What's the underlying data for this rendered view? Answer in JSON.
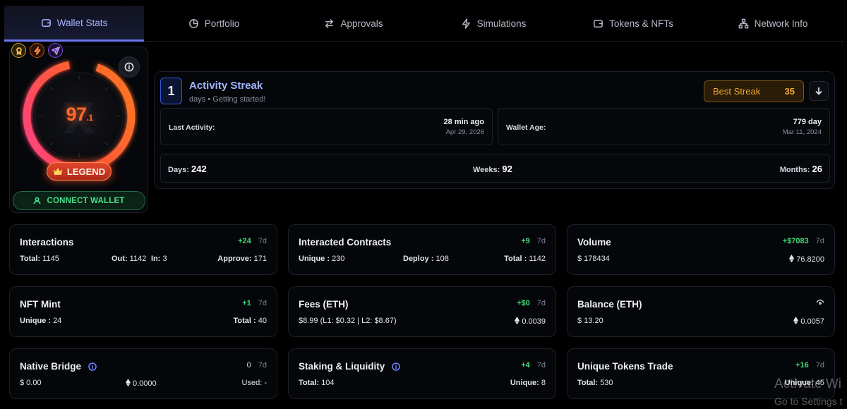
{
  "tabs": [
    {
      "label": "Wallet Stats",
      "icon": "wallet-icon"
    },
    {
      "label": "Portfolio",
      "icon": "pie-chart-icon"
    },
    {
      "label": "Approvals",
      "icon": "swap-arrows-icon"
    },
    {
      "label": "Simulations",
      "icon": "lightning-icon"
    },
    {
      "label": "Tokens & NFTs",
      "icon": "wallet-icon"
    },
    {
      "label": "Network Info",
      "icon": "network-icon"
    }
  ],
  "score": {
    "value": "97",
    "decimal": ".1",
    "rank": "LEGEND",
    "connect_label": "CONNECT WALLET",
    "badges": [
      "medal-icon",
      "lightning-icon",
      "send-icon"
    ],
    "colors": {
      "accent": "#ff6a2b",
      "ring_start": "#ff3d8a",
      "ring_end": "#ff7a1f"
    }
  },
  "streak": {
    "count": "1",
    "title": "Activity Streak",
    "subtitle": "days • Getting started!",
    "best_label": "Best Streak",
    "best_value": "35",
    "last_activity_label": "Last Activity:",
    "last_activity_value": "28 min ago",
    "last_activity_date": "Apr 29, 2026",
    "wallet_age_label": "Wallet Age:",
    "wallet_age_value": "779 day",
    "wallet_age_date": "Mar 11, 2024",
    "days_label": "Days:",
    "days_value": "242",
    "weeks_label": "Weeks:",
    "weeks_value": "92",
    "months_label": "Months:",
    "months_value": "26"
  },
  "stats": {
    "interactions": {
      "title": "Interactions",
      "delta": "+24",
      "period": "7d",
      "total_label": "Total:",
      "total": "1145",
      "out_label": "Out:",
      "out": "1142",
      "in_label": "In:",
      "in": "3",
      "approve_label": "Approve:",
      "approve": "171"
    },
    "contracts": {
      "title": "Interacted Contracts",
      "delta": "+9",
      "period": "7d",
      "unique_label": "Unique :",
      "unique": "230",
      "deploy_label": "Deploy :",
      "deploy": "108",
      "total_label": "Total :",
      "total": "1142"
    },
    "volume": {
      "title": "Volume",
      "delta": "+$7083",
      "period": "7d",
      "usd": "$ 178434",
      "eth": "76.8200"
    },
    "nft": {
      "title": "NFT Mint",
      "delta": "+1",
      "period": "7d",
      "unique_label": "Unique :",
      "unique": "24",
      "total_label": "Total :",
      "total": "40"
    },
    "fees": {
      "title": "Fees (ETH)",
      "delta": "+$0",
      "period": "7d",
      "detail": "$8.99 (L1: $0.32 | L2: $8.67)",
      "eth": "0.0039"
    },
    "balance": {
      "title": "Balance (ETH)",
      "usd": "$ 13.20",
      "eth": "0.0057"
    },
    "bridge": {
      "title": "Native Bridge",
      "delta": "0",
      "period": "7d",
      "usd": "$ 0.00",
      "eth": "0.0000",
      "used_label": "Used:",
      "used": "-"
    },
    "staking": {
      "title": "Staking & Liquidity",
      "delta": "+4",
      "period": "7d",
      "total_label": "Total:",
      "total": "104",
      "unique_label": "Unique:",
      "unique": "8"
    },
    "tokens": {
      "title": "Unique Tokens Trade",
      "delta": "+16",
      "period": "7d",
      "total_label": "Total:",
      "total": "530",
      "unique_label": "Unique:",
      "unique": "45"
    }
  },
  "watermark": {
    "line1": "Activate Wi",
    "line2": "Go to Settings t"
  }
}
